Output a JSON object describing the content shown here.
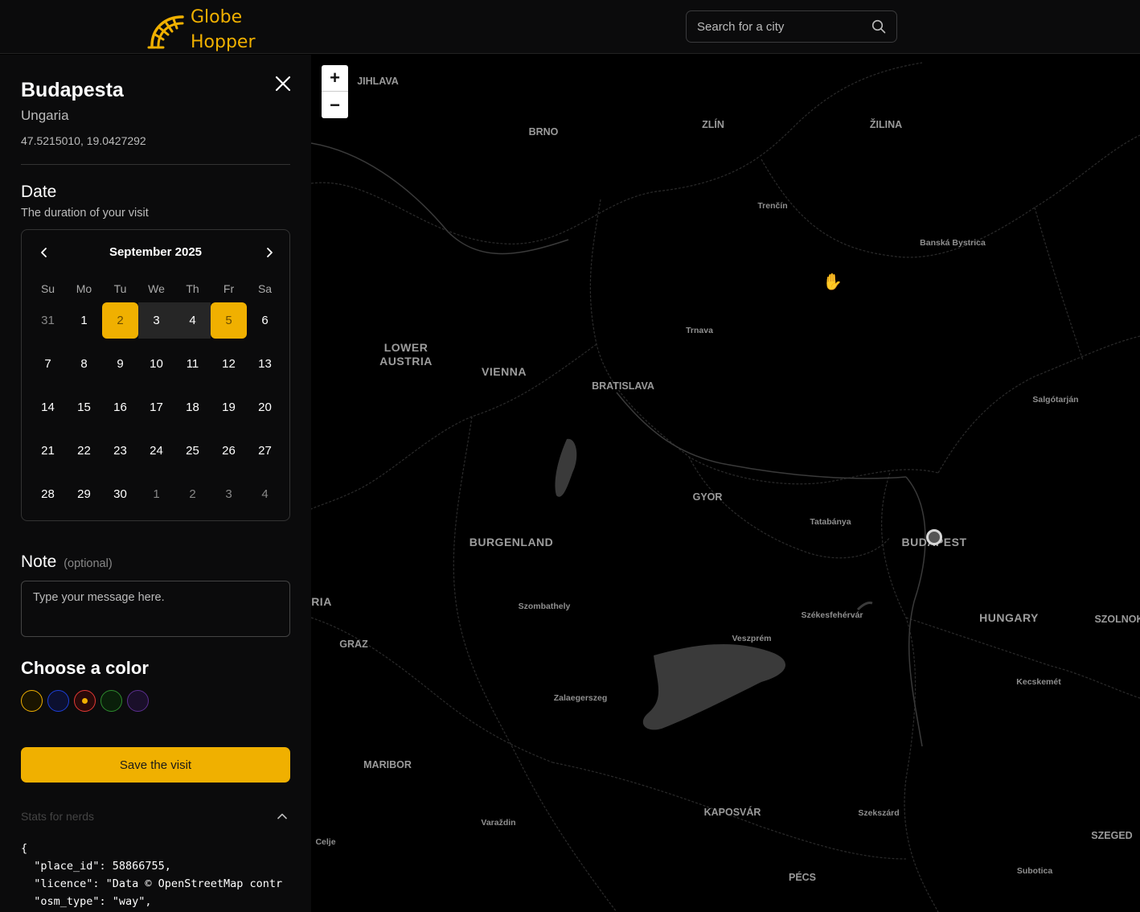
{
  "header": {
    "logo_line1": "Globe",
    "logo_line2": "Hopper",
    "search_placeholder": "Search for a city",
    "search_icon": "search-icon",
    "logo_icon": "globe-arc-icon",
    "accent_color": "#f0b000"
  },
  "sidebar": {
    "city": "Budapesta",
    "country": "Ungaria",
    "coords": "47.5215010, 19.0427292",
    "date_title": "Date",
    "date_subtitle": "The duration of your visit",
    "calendar": {
      "month": "September 2025",
      "weekdays": [
        "Su",
        "Mo",
        "Tu",
        "We",
        "Th",
        "Fr",
        "Sa"
      ],
      "weeks": [
        [
          "31",
          "1",
          "2",
          "3",
          "4",
          "5",
          "6"
        ],
        [
          "7",
          "8",
          "9",
          "10",
          "11",
          "12",
          "13"
        ],
        [
          "14",
          "15",
          "16",
          "17",
          "18",
          "19",
          "20"
        ],
        [
          "21",
          "22",
          "23",
          "24",
          "25",
          "26",
          "27"
        ],
        [
          "28",
          "29",
          "30",
          "1",
          "2",
          "3",
          "4"
        ]
      ],
      "selected_start": "2",
      "selected_end": "5"
    },
    "note_title": "Note",
    "note_optional": "(optional)",
    "note_placeholder": "Type your message here.",
    "color_title": "Choose a color",
    "colors": [
      "#f0b000",
      "#1d3fd8",
      "#e53935",
      "#2e8b2e",
      "#5b2e8f"
    ],
    "selected_color_index": 2,
    "save_label": "Save the visit",
    "stats_label": "Stats for nerds",
    "stats_code": "{\n  \"place_id\": 58866755,\n  \"licence\": \"Data © OpenStreetMap contr\n  \"osm_type\": \"way\","
  },
  "map": {
    "zoom_in": "+",
    "zoom_out": "−",
    "labels": [
      {
        "text": "JIHLAVA",
        "size": "med"
      },
      {
        "text": "BRNO",
        "size": "med"
      },
      {
        "text": "ZLÍN",
        "size": "med"
      },
      {
        "text": "ŽILINA",
        "size": "med"
      },
      {
        "text": "Trenčín",
        "size": "sm"
      },
      {
        "text": "Banská Bystrica",
        "size": "sm"
      },
      {
        "text": "Trnava",
        "size": "sm"
      },
      {
        "text": "LOWER\nAUSTRIA",
        "size": "big"
      },
      {
        "text": "VIENNA",
        "size": "big"
      },
      {
        "text": "BRATISLAVA",
        "size": "med"
      },
      {
        "text": "Salgótarján",
        "size": "sm"
      },
      {
        "text": "GYOR",
        "size": "med"
      },
      {
        "text": "Tatabánya",
        "size": "sm"
      },
      {
        "text": "BUDAPEST",
        "size": "big"
      },
      {
        "text": "BURGENLAND",
        "size": "big"
      },
      {
        "text": "RIA",
        "size": "big"
      },
      {
        "text": "Szombathely",
        "size": "sm"
      },
      {
        "text": "Székesfehérvár",
        "size": "sm"
      },
      {
        "text": "HUNGARY",
        "size": "big"
      },
      {
        "text": "SZOLNOK",
        "size": "med"
      },
      {
        "text": "GRAZ",
        "size": "med"
      },
      {
        "text": "Veszprém",
        "size": "sm"
      },
      {
        "text": "Kecskemét",
        "size": "sm"
      },
      {
        "text": "Zalaegerszeg",
        "size": "sm"
      },
      {
        "text": "MARIBOR",
        "size": "med"
      },
      {
        "text": "KAPOSVÁR",
        "size": "med"
      },
      {
        "text": "Szekszárd",
        "size": "sm"
      },
      {
        "text": "Varaždin",
        "size": "sm"
      },
      {
        "text": "SZEGED",
        "size": "med"
      },
      {
        "text": "Celje",
        "size": "sm"
      },
      {
        "text": "PÉCS",
        "size": "med"
      },
      {
        "text": "Subotica",
        "size": "sm"
      }
    ]
  }
}
